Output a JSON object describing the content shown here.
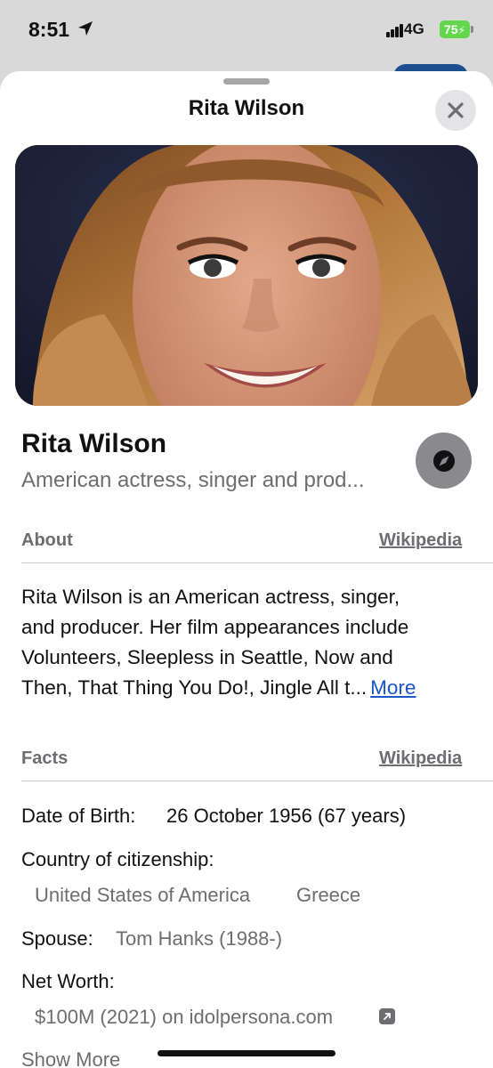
{
  "status_bar": {
    "time": "8:51",
    "network": "4G",
    "battery": "75"
  },
  "sheet": {
    "title": "Rita Wilson"
  },
  "profile": {
    "name": "Rita Wilson",
    "subtitle": "American actress, singer and prod..."
  },
  "about": {
    "heading": "About",
    "source_link": "Wikipedia",
    "lines": [
      "Rita Wilson is an American actress, singer,",
      "and producer. Her film appearances include",
      "Volunteers, Sleepless in Seattle, Now and",
      "Then, That Thing You Do!, Jingle All t..."
    ],
    "more_link": "More"
  },
  "facts": {
    "heading": "Facts",
    "source_link": "Wikipedia",
    "dob_label": "Date of Birth:",
    "dob_value": "26 October 1956 (67 years)",
    "citizenship_label": "Country of citizenship:",
    "citizenship_values": [
      "United States of America",
      "Greece"
    ],
    "spouse_label": "Spouse:",
    "spouse_value": "Tom Hanks (1988-)",
    "networth_label": "Net Worth:",
    "networth_value": "$100M (2021) on idolpersona.com",
    "show_more": "Show More"
  },
  "colors": {
    "link_blue": "#1a56c7",
    "secondary_gray": "#6d6d72",
    "battery_green": "#64d64e"
  },
  "icons": {
    "close": "close-icon",
    "compass": "compass-icon",
    "external_link": "external-link-icon",
    "location": "location-arrow-icon"
  }
}
